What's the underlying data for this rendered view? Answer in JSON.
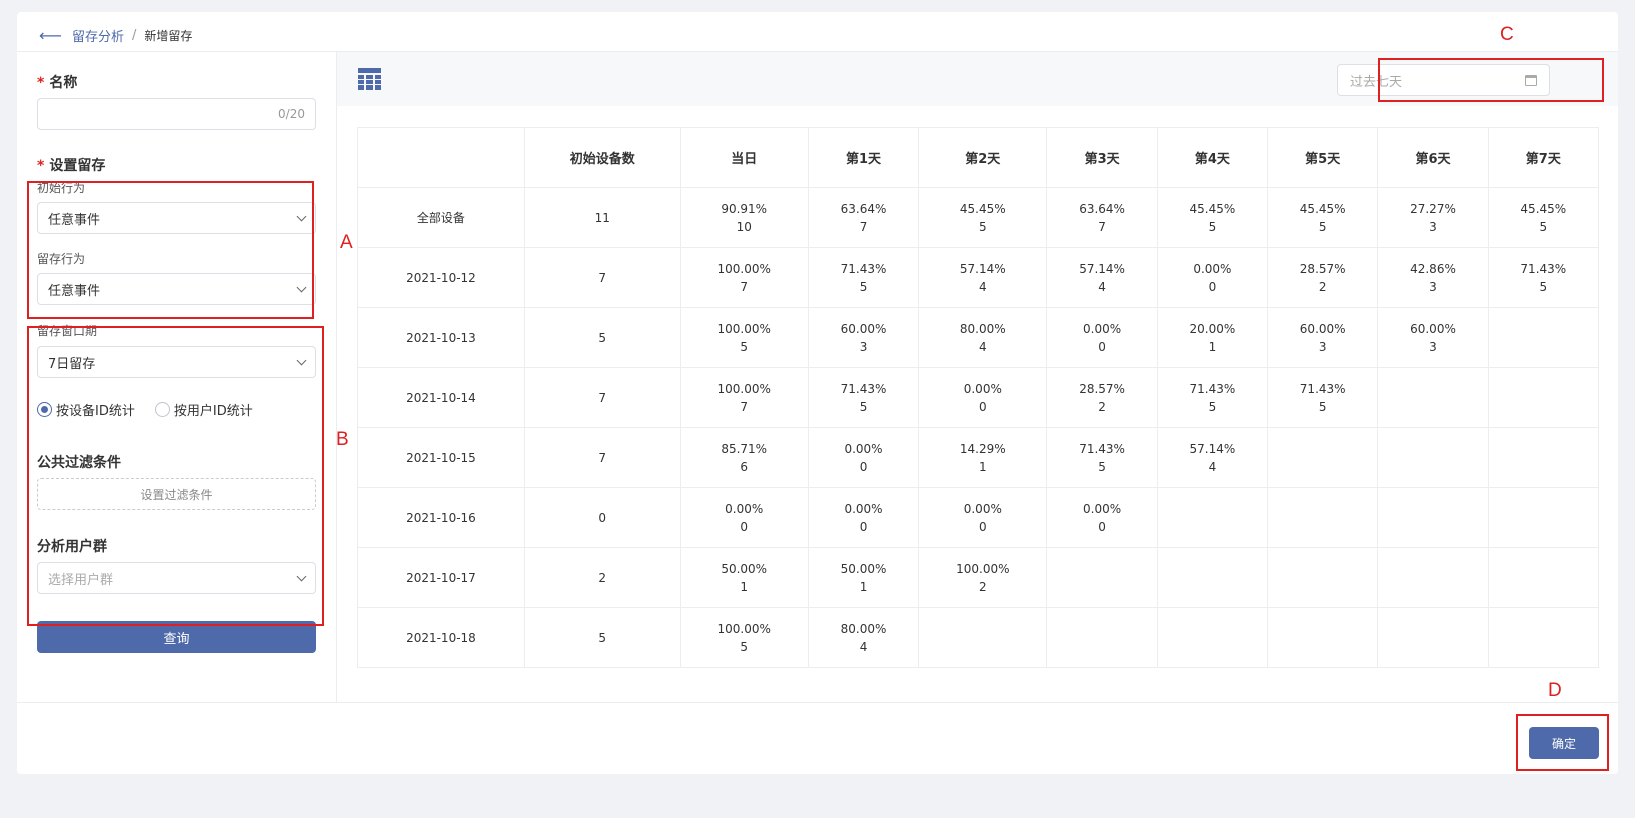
{
  "breadcrumb": {
    "back_icon": "arrow-left-icon",
    "parent": "留存分析",
    "separator": "/",
    "current": "新增留存"
  },
  "form": {
    "name_label": "名称",
    "name_counter": "0/20",
    "retention_label": "设置留存",
    "initial_action_label": "初始行为",
    "initial_action_value": "任意事件",
    "retention_action_label": "留存行为",
    "retention_action_value": "任意事件",
    "window_label": "留存窗口期",
    "window_value": "7日留存",
    "radio_device": "按设备ID统计",
    "radio_user": "按用户ID统计",
    "filter_label": "公共过滤条件",
    "filter_button": "设置过滤条件",
    "group_label": "分析用户群",
    "group_placeholder": "选择用户群",
    "query_button": "查询"
  },
  "toolbar": {
    "grid_icon": "table-grid-icon",
    "date_placeholder": "过去七天"
  },
  "table": {
    "headers": [
      "",
      "初始设备数",
      "当日",
      "第1天",
      "第2天",
      "第3天",
      "第4天",
      "第5天",
      "第6天",
      "第7天"
    ],
    "rows": [
      {
        "label": "全部设备",
        "initial": "11",
        "cells": [
          [
            "90.91%",
            "10"
          ],
          [
            "63.64%",
            "7"
          ],
          [
            "45.45%",
            "5"
          ],
          [
            "63.64%",
            "7"
          ],
          [
            "45.45%",
            "5"
          ],
          [
            "45.45%",
            "5"
          ],
          [
            "27.27%",
            "3"
          ],
          [
            "45.45%",
            "5"
          ]
        ]
      },
      {
        "label": "2021-10-12",
        "initial": "7",
        "cells": [
          [
            "100.00%",
            "7"
          ],
          [
            "71.43%",
            "5"
          ],
          [
            "57.14%",
            "4"
          ],
          [
            "57.14%",
            "4"
          ],
          [
            "0.00%",
            "0"
          ],
          [
            "28.57%",
            "2"
          ],
          [
            "42.86%",
            "3"
          ],
          [
            "71.43%",
            "5"
          ]
        ]
      },
      {
        "label": "2021-10-13",
        "initial": "5",
        "cells": [
          [
            "100.00%",
            "5"
          ],
          [
            "60.00%",
            "3"
          ],
          [
            "80.00%",
            "4"
          ],
          [
            "0.00%",
            "0"
          ],
          [
            "20.00%",
            "1"
          ],
          [
            "60.00%",
            "3"
          ],
          [
            "60.00%",
            "3"
          ]
        ]
      },
      {
        "label": "2021-10-14",
        "initial": "7",
        "cells": [
          [
            "100.00%",
            "7"
          ],
          [
            "71.43%",
            "5"
          ],
          [
            "0.00%",
            "0"
          ],
          [
            "28.57%",
            "2"
          ],
          [
            "71.43%",
            "5"
          ],
          [
            "71.43%",
            "5"
          ]
        ]
      },
      {
        "label": "2021-10-15",
        "initial": "7",
        "cells": [
          [
            "85.71%",
            "6"
          ],
          [
            "0.00%",
            "0"
          ],
          [
            "14.29%",
            "1"
          ],
          [
            "71.43%",
            "5"
          ],
          [
            "57.14%",
            "4"
          ]
        ]
      },
      {
        "label": "2021-10-16",
        "initial": "0",
        "cells": [
          [
            "0.00%",
            "0"
          ],
          [
            "0.00%",
            "0"
          ],
          [
            "0.00%",
            "0"
          ],
          [
            "0.00%",
            "0"
          ]
        ]
      },
      {
        "label": "2021-10-17",
        "initial": "2",
        "cells": [
          [
            "50.00%",
            "1"
          ],
          [
            "50.00%",
            "1"
          ],
          [
            "100.00%",
            "2"
          ]
        ]
      },
      {
        "label": "2021-10-18",
        "initial": "5",
        "cells": [
          [
            "100.00%",
            "5"
          ],
          [
            "80.00%",
            "4"
          ]
        ]
      }
    ]
  },
  "confirm_button": "确定",
  "annotations": {
    "a": "A",
    "b": "B",
    "c": "C",
    "d": "D"
  },
  "colors": {
    "primary": "#4e6aaa",
    "annotation": "#e02020"
  }
}
